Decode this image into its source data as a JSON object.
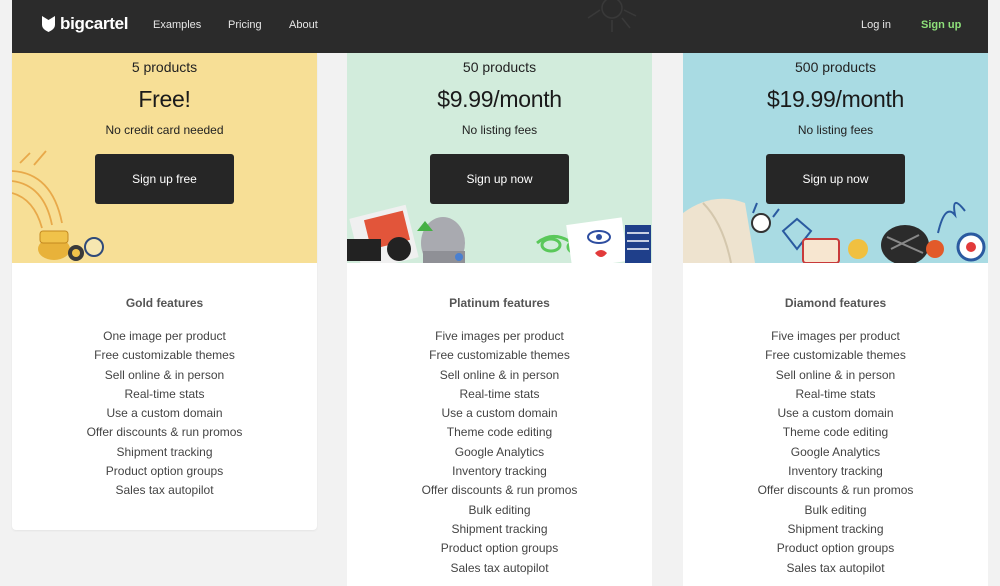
{
  "nav": {
    "brand": "bigcartel",
    "links": [
      "Examples",
      "Pricing",
      "About"
    ],
    "login": "Log in",
    "signup": "Sign up",
    "signup_color": "#8ee07a"
  },
  "plans": [
    {
      "products": "5 products",
      "price": "Free!",
      "note": "No credit card needed",
      "cta": "Sign up free",
      "features_title": "Gold features",
      "features": [
        "One image per product",
        "Free customizable themes",
        "Sell online & in person",
        "Real-time stats",
        "Use a custom domain",
        "Offer discounts & run promos",
        "Shipment tracking",
        "Product option groups",
        "Sales tax autopilot"
      ],
      "color": "#f7df96"
    },
    {
      "products": "50 products",
      "price": "$9.99/month",
      "note": "No listing fees",
      "cta": "Sign up now",
      "features_title": "Platinum features",
      "features": [
        "Five images per product",
        "Free customizable themes",
        "Sell online & in person",
        "Real-time stats",
        "Use a custom domain",
        "Theme code editing",
        "Google Analytics",
        "Inventory tracking",
        "Offer discounts & run promos",
        "Bulk editing",
        "Shipment tracking",
        "Product option groups",
        "Sales tax autopilot"
      ],
      "color": "#d2ecdc"
    },
    {
      "products": "500 products",
      "price": "$19.99/month",
      "note": "No listing fees",
      "cta": "Sign up now",
      "features_title": "Diamond features",
      "features": [
        "Five images per product",
        "Free customizable themes",
        "Sell online & in person",
        "Real-time stats",
        "Use a custom domain",
        "Theme code editing",
        "Google Analytics",
        "Inventory tracking",
        "Offer discounts & run promos",
        "Bulk editing",
        "Shipment tracking",
        "Product option groups",
        "Sales tax autopilot"
      ],
      "color": "#a9dbe3"
    }
  ]
}
